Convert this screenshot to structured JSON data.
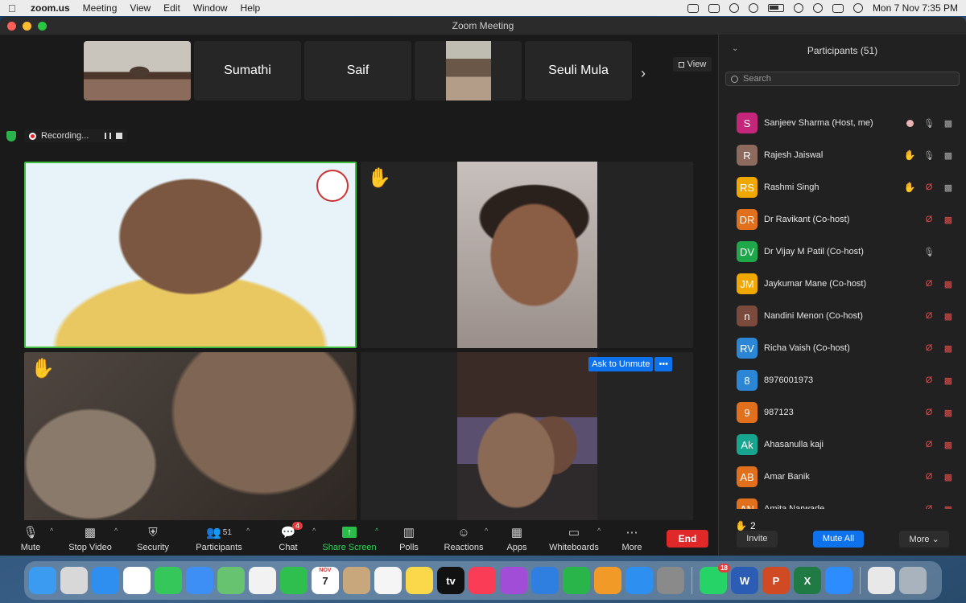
{
  "menubar": {
    "app": "zoom.us",
    "menus": [
      "Meeting",
      "View",
      "Edit",
      "Window",
      "Help"
    ],
    "clock": "Mon 7 Nov  7:35 PM"
  },
  "window": {
    "title": "Zoom Meeting"
  },
  "thumbnails": [
    "Sumathi",
    "Saif",
    "Seuli Mula"
  ],
  "view_label": "View",
  "recording_label": "Recording...",
  "ask_to_unmute": "Ask to Unmute",
  "more_dots": "•••",
  "toolbar": {
    "mute": "Mute",
    "stop_video": "Stop Video",
    "security": "Security",
    "participants": "Participants",
    "participants_count": "51",
    "chat": "Chat",
    "chat_badge": "4",
    "share_screen": "Share Screen",
    "polls": "Polls",
    "reactions": "Reactions",
    "apps": "Apps",
    "whiteboards": "Whiteboards",
    "more": "More",
    "end": "End"
  },
  "panel": {
    "title": "Participants (51)",
    "search_placeholder": "Search",
    "raised_hands_count": "2",
    "invite": "Invite",
    "mute_all": "Mute All",
    "more": "More"
  },
  "participants": [
    {
      "initials": "S",
      "name": "Sanjeev Sharma (Host, me)",
      "color": "#c4267a",
      "mic": "on",
      "video": "on",
      "recording": true,
      "hand": false
    },
    {
      "initials": "R",
      "name": "Rajesh Jaiswal",
      "color": "#8c6a5d",
      "mic": "on",
      "video": "on",
      "hand": true
    },
    {
      "initials": "RS",
      "name": "Rashmi Singh",
      "color": "#f0a800",
      "mic": "off",
      "video": "on",
      "hand": true
    },
    {
      "initials": "DR",
      "name": "Dr Ravikant (Co-host)",
      "color": "#e0701c",
      "mic": "off",
      "video": "off",
      "hand": false
    },
    {
      "initials": "DV",
      "name": "Dr Vijay M Patil (Co-host)",
      "color": "#1ea84a",
      "mic": "on",
      "video": "none",
      "hand": false
    },
    {
      "initials": "JM",
      "name": "Jaykumar Mane (Co-host)",
      "color": "#f0a800",
      "mic": "off",
      "video": "off",
      "hand": false
    },
    {
      "initials": "n",
      "name": "Nandini Menon (Co-host)",
      "color": "#7a4a3c",
      "mic": "off",
      "video": "off",
      "hand": false
    },
    {
      "initials": "RV",
      "name": "Richa Vaish (Co-host)",
      "color": "#2b86d6",
      "mic": "off",
      "video": "off",
      "hand": false
    },
    {
      "initials": "8",
      "name": "8976001973",
      "color": "#2b86d6",
      "mic": "off",
      "video": "off",
      "hand": false
    },
    {
      "initials": "9",
      "name": "987123",
      "color": "#e0701c",
      "mic": "off",
      "video": "off",
      "hand": false
    },
    {
      "initials": "Ak",
      "name": "Ahasanulla kaji",
      "color": "#18a58f",
      "mic": "off",
      "video": "off",
      "hand": false
    },
    {
      "initials": "AB",
      "name": "Amar Banik",
      "color": "#e0701c",
      "mic": "off",
      "video": "off",
      "hand": false
    },
    {
      "initials": "AN",
      "name": "Amita Narwade",
      "color": "#e0701c",
      "mic": "off",
      "video": "off",
      "hand": false
    }
  ],
  "dock": {
    "apps": [
      {
        "name": "finder",
        "color": "#3a9bf0"
      },
      {
        "name": "launchpad",
        "color": "#d8d8d8"
      },
      {
        "name": "safari",
        "color": "#2f8ff0"
      },
      {
        "name": "chrome",
        "color": "#ffffff"
      },
      {
        "name": "messages",
        "color": "#35c759"
      },
      {
        "name": "mail",
        "color": "#3d8ef5"
      },
      {
        "name": "maps",
        "color": "#67c36f"
      },
      {
        "name": "photos",
        "color": "#f2f2f2"
      },
      {
        "name": "facetime",
        "color": "#2fbf4f"
      },
      {
        "name": "calendar",
        "color": "#ffffff",
        "label": "7",
        "month": "NOV"
      },
      {
        "name": "contacts",
        "color": "#c9a77c"
      },
      {
        "name": "reminders",
        "color": "#f5f5f5"
      },
      {
        "name": "notes",
        "color": "#fbd84a"
      },
      {
        "name": "tv",
        "color": "#111111",
        "label": "tv"
      },
      {
        "name": "music",
        "color": "#fa3c56"
      },
      {
        "name": "podcasts",
        "color": "#a24dd8"
      },
      {
        "name": "keynote",
        "color": "#2f7fe0"
      },
      {
        "name": "numbers",
        "color": "#29b54a"
      },
      {
        "name": "pages",
        "color": "#f29a28"
      },
      {
        "name": "app-store",
        "color": "#2d8ff0"
      },
      {
        "name": "system-settings",
        "color": "#8a8a8a"
      },
      {
        "name": "whatsapp",
        "color": "#25d366",
        "badge": "18"
      },
      {
        "name": "word",
        "color": "#2b5db5",
        "label": "W"
      },
      {
        "name": "powerpoint",
        "color": "#d04a23",
        "label": "P"
      },
      {
        "name": "excel",
        "color": "#1f7a43",
        "label": "X"
      },
      {
        "name": "zoom",
        "color": "#2d8cff"
      },
      {
        "name": "preview",
        "color": "#e8e8e8"
      },
      {
        "name": "trash",
        "color": "#a9b3bd"
      }
    ]
  }
}
